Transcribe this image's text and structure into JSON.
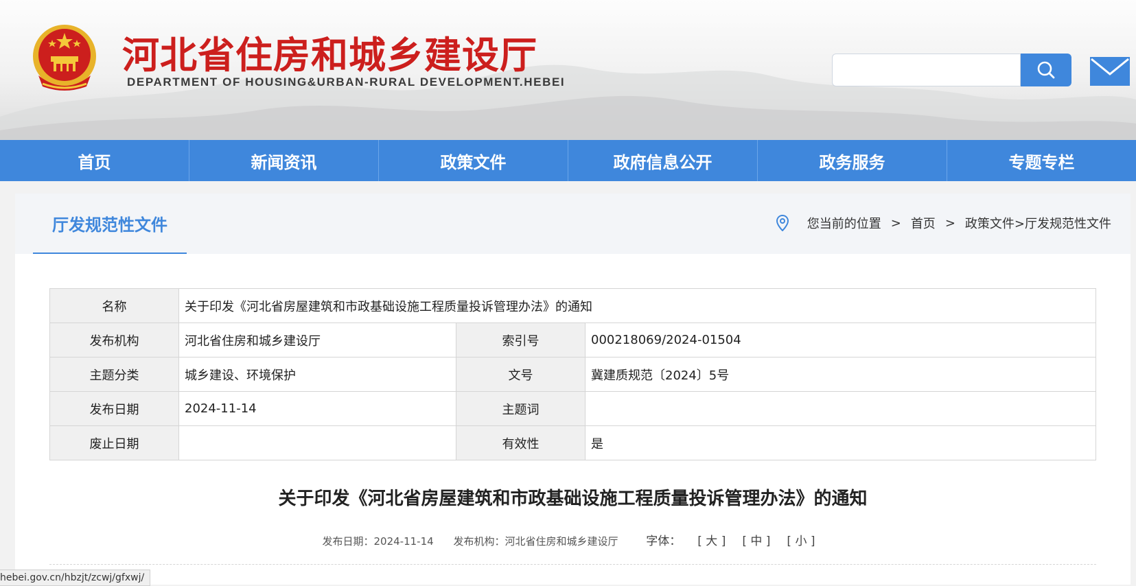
{
  "header": {
    "title_cn": "河北省住房和城乡建设厅",
    "title_en": "DEPARTMENT OF HOUSING&URBAN-RURAL DEVELOPMENT.HEBEI",
    "search": {
      "value": "",
      "placeholder": ""
    },
    "icons": {
      "emblem": "national-emblem",
      "search": "search-icon",
      "mail": "mail-icon"
    },
    "colors": {
      "title_red": "#cc1f1d",
      "accent_blue": "#3f87dc"
    }
  },
  "nav": {
    "items": [
      {
        "label": "首页"
      },
      {
        "label": "新闻资讯"
      },
      {
        "label": "政策文件"
      },
      {
        "label": "政府信息公开"
      },
      {
        "label": "政务服务"
      },
      {
        "label": "专题专栏"
      }
    ]
  },
  "section": {
    "title": "厅发规范性文件",
    "breadcrumb": {
      "prefix": "您当前的位置",
      "sep": ">",
      "home": "首页",
      "path": "政策文件>厅发规范性文件"
    }
  },
  "info": {
    "name_label": "名称",
    "name_value": "关于印发《河北省房屋建筑和市政基础设施工程质量投诉管理办法》的通知",
    "publisher_label": "发布机构",
    "publisher_value": "河北省住房和城乡建设厅",
    "index_label": "索引号",
    "index_value": "000218069/2024-01504",
    "topic_label": "主题分类",
    "topic_value": "城乡建设、环境保护",
    "docno_label": "文号",
    "docno_value": "冀建质规范〔2024〕5号",
    "date_label": "发布日期",
    "date_value": "2024-11-14",
    "keywords_label": "主题词",
    "keywords_value": "",
    "expire_label": "废止日期",
    "expire_value": "",
    "validity_label": "有效性",
    "validity_value": "是"
  },
  "article": {
    "title": "关于印发《河北省房屋建筑和市政基础设施工程质量投诉管理办法》的通知",
    "meta_date": "发布日期：2024-11-14",
    "meta_publisher": "发布机构：河北省住房和城乡建设厅",
    "font_label": "字体：",
    "font_large": "[ 大 ]",
    "font_medium": "[ 中 ]",
    "font_small": "[ 小 ]"
  },
  "status_bar": {
    "url": "hebei.gov.cn/hbzjt/zcwj/gfxwj/"
  }
}
